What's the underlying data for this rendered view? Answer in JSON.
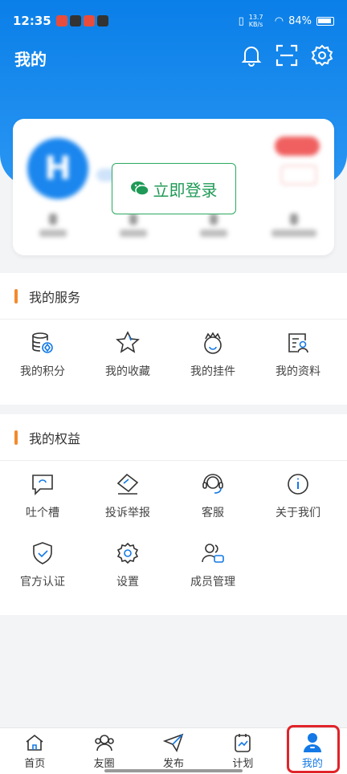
{
  "status_bar": {
    "time": "12:35",
    "net_speed": "13.7 KB/s",
    "battery": "84%"
  },
  "header": {
    "title": "我的"
  },
  "profile": {
    "avatar_letter": "H",
    "login_label": "立即登录"
  },
  "services": {
    "title": "我的服务",
    "items": [
      {
        "label": "我的积分",
        "icon": "points-icon"
      },
      {
        "label": "我的收藏",
        "icon": "star-icon"
      },
      {
        "label": "我的挂件",
        "icon": "pendant-icon"
      },
      {
        "label": "我的资料",
        "icon": "profile-card-icon"
      }
    ]
  },
  "rights": {
    "title": "我的权益",
    "items": [
      {
        "label": "吐个槽",
        "icon": "feedback-icon"
      },
      {
        "label": "投诉举报",
        "icon": "report-icon"
      },
      {
        "label": "客服",
        "icon": "headset-icon"
      },
      {
        "label": "关于我们",
        "icon": "info-icon"
      },
      {
        "label": "官方认证",
        "icon": "shield-check-icon"
      },
      {
        "label": "设置",
        "icon": "gear-icon"
      },
      {
        "label": "成员管理",
        "icon": "members-icon"
      }
    ]
  },
  "tabbar": {
    "items": [
      {
        "label": "首页",
        "icon": "home-icon"
      },
      {
        "label": "友圈",
        "icon": "friends-icon"
      },
      {
        "label": "发布",
        "icon": "paper-plane-icon"
      },
      {
        "label": "计划",
        "icon": "plan-chart-icon"
      },
      {
        "label": "我的",
        "icon": "person-icon",
        "active": true
      }
    ]
  },
  "colors": {
    "primary": "#0a7fe8",
    "accent_bar": "#f38a2c",
    "wechat_green": "#1f9a56",
    "highlight_red": "#e0242a"
  }
}
